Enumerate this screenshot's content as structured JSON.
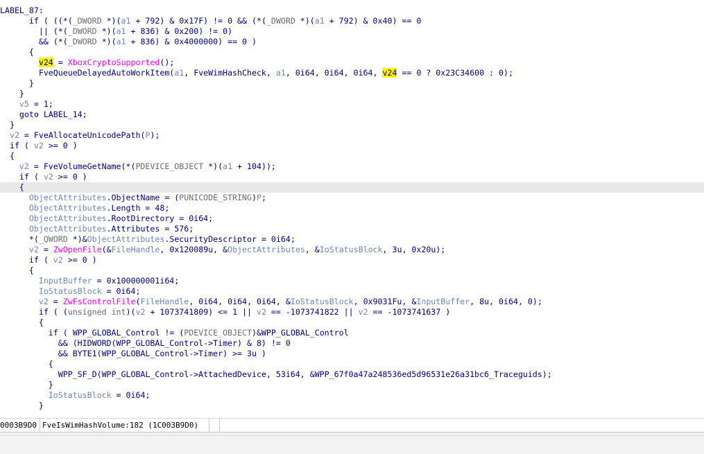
{
  "code_lines": [
    {
      "current": false,
      "tokens": [
        {
          "t": "LABEL_87:",
          "c": "label"
        }
      ]
    },
    {
      "current": false,
      "tokens": [
        {
          "t": "      if ( ((*(",
          "c": "plain"
        },
        {
          "t": "_DWORD",
          "c": "type"
        },
        {
          "t": " *)(",
          "c": "plain"
        },
        {
          "t": "a1",
          "c": "var"
        },
        {
          "t": " + 792) & 0x17F) != 0 && (*(",
          "c": "plain"
        },
        {
          "t": "_DWORD",
          "c": "type"
        },
        {
          "t": " *)(",
          "c": "plain"
        },
        {
          "t": "a1",
          "c": "var"
        },
        {
          "t": " + 792) & 0x40) == 0",
          "c": "plain"
        }
      ]
    },
    {
      "current": false,
      "tokens": [
        {
          "t": "        || (*(",
          "c": "plain"
        },
        {
          "t": "_DWORD",
          "c": "type"
        },
        {
          "t": " *)(",
          "c": "plain"
        },
        {
          "t": "a1",
          "c": "var"
        },
        {
          "t": " + 836) & 0x200) != 0)",
          "c": "plain"
        }
      ]
    },
    {
      "current": false,
      "tokens": [
        {
          "t": "        && (*(",
          "c": "plain"
        },
        {
          "t": "_DWORD",
          "c": "type"
        },
        {
          "t": " *)(",
          "c": "plain"
        },
        {
          "t": "a1",
          "c": "var"
        },
        {
          "t": " + 836) & 0x4000000) == 0 )",
          "c": "plain"
        }
      ]
    },
    {
      "current": false,
      "tokens": [
        {
          "t": "      {",
          "c": "plain"
        }
      ]
    },
    {
      "current": false,
      "tokens": [
        {
          "t": "        ",
          "c": "plain"
        },
        {
          "t": "v24",
          "c": "hl"
        },
        {
          "t": " = ",
          "c": "plain"
        },
        {
          "t": "XboxCryptoSupported",
          "c": "fn"
        },
        {
          "t": "();",
          "c": "plain"
        }
      ]
    },
    {
      "current": false,
      "tokens": [
        {
          "t": "        FveQueueDelayedAutoWorkItem(",
          "c": "plain"
        },
        {
          "t": "a1",
          "c": "var"
        },
        {
          "t": ", FveWimHashCheck, ",
          "c": "plain"
        },
        {
          "t": "a1",
          "c": "var"
        },
        {
          "t": ", 0i64, 0i64, 0i64, ",
          "c": "plain"
        },
        {
          "t": "v24",
          "c": "hl"
        },
        {
          "t": " == 0 ? 0x23C34600 : 0);",
          "c": "plain"
        }
      ]
    },
    {
      "current": false,
      "tokens": [
        {
          "t": "      }",
          "c": "plain"
        }
      ]
    },
    {
      "current": false,
      "tokens": [
        {
          "t": "    }",
          "c": "plain"
        }
      ]
    },
    {
      "current": false,
      "tokens": [
        {
          "t": "    ",
          "c": "plain"
        },
        {
          "t": "v5",
          "c": "var"
        },
        {
          "t": " = 1;",
          "c": "plain"
        }
      ]
    },
    {
      "current": false,
      "tokens": [
        {
          "t": "    goto LABEL_14;",
          "c": "plain"
        }
      ]
    },
    {
      "current": false,
      "tokens": [
        {
          "t": "  }",
          "c": "plain"
        }
      ]
    },
    {
      "current": false,
      "tokens": [
        {
          "t": "  ",
          "c": "plain"
        },
        {
          "t": "v2",
          "c": "var"
        },
        {
          "t": " = FveAllocateUnicodePath(",
          "c": "plain"
        },
        {
          "t": "P",
          "c": "var"
        },
        {
          "t": ");",
          "c": "plain"
        }
      ]
    },
    {
      "current": false,
      "tokens": [
        {
          "t": "  if ( ",
          "c": "plain"
        },
        {
          "t": "v2",
          "c": "var"
        },
        {
          "t": " >= 0 )",
          "c": "plain"
        }
      ]
    },
    {
      "current": false,
      "tokens": [
        {
          "t": "  {",
          "c": "plain"
        }
      ]
    },
    {
      "current": false,
      "tokens": [
        {
          "t": "    ",
          "c": "plain"
        },
        {
          "t": "v2",
          "c": "var"
        },
        {
          "t": " = FveVolumeGetName(*(",
          "c": "plain"
        },
        {
          "t": "PDEVICE_OBJECT",
          "c": "type"
        },
        {
          "t": " *)(",
          "c": "plain"
        },
        {
          "t": "a1",
          "c": "var"
        },
        {
          "t": " + 104));",
          "c": "plain"
        }
      ]
    },
    {
      "current": false,
      "tokens": [
        {
          "t": "    if ( ",
          "c": "plain"
        },
        {
          "t": "v2",
          "c": "var"
        },
        {
          "t": " >= 0 )",
          "c": "plain"
        }
      ]
    },
    {
      "current": true,
      "tokens": [
        {
          "t": "    {",
          "c": "plain"
        }
      ]
    },
    {
      "current": false,
      "tokens": [
        {
          "t": "      ",
          "c": "plain"
        },
        {
          "t": "ObjectAttributes",
          "c": "var"
        },
        {
          "t": ".ObjectName = (",
          "c": "plain"
        },
        {
          "t": "PUNICODE_STRING",
          "c": "type"
        },
        {
          "t": ")",
          "c": "plain"
        },
        {
          "t": "P",
          "c": "var"
        },
        {
          "t": ";",
          "c": "plain"
        }
      ]
    },
    {
      "current": false,
      "tokens": [
        {
          "t": "      ",
          "c": "plain"
        },
        {
          "t": "ObjectAttributes",
          "c": "var"
        },
        {
          "t": ".Length = 48;",
          "c": "plain"
        }
      ]
    },
    {
      "current": false,
      "tokens": [
        {
          "t": "      ",
          "c": "plain"
        },
        {
          "t": "ObjectAttributes",
          "c": "var"
        },
        {
          "t": ".RootDirectory = 0i64;",
          "c": "plain"
        }
      ]
    },
    {
      "current": false,
      "tokens": [
        {
          "t": "      ",
          "c": "plain"
        },
        {
          "t": "ObjectAttributes",
          "c": "var"
        },
        {
          "t": ".Attributes = 576;",
          "c": "plain"
        }
      ]
    },
    {
      "current": false,
      "tokens": [
        {
          "t": "      *(",
          "c": "plain"
        },
        {
          "t": "_QWORD",
          "c": "type"
        },
        {
          "t": " *)&",
          "c": "plain"
        },
        {
          "t": "ObjectAttributes",
          "c": "var"
        },
        {
          "t": ".SecurityDescriptor = 0i64;",
          "c": "plain"
        }
      ]
    },
    {
      "current": false,
      "tokens": [
        {
          "t": "      ",
          "c": "plain"
        },
        {
          "t": "v2",
          "c": "var"
        },
        {
          "t": " = ",
          "c": "plain"
        },
        {
          "t": "ZwOpenFile",
          "c": "fn"
        },
        {
          "t": "(&",
          "c": "plain"
        },
        {
          "t": "FileHandle",
          "c": "var"
        },
        {
          "t": ", 0x120089u, &",
          "c": "plain"
        },
        {
          "t": "ObjectAttributes",
          "c": "var"
        },
        {
          "t": ", &",
          "c": "plain"
        },
        {
          "t": "IoStatusBlock",
          "c": "var"
        },
        {
          "t": ", 3u, 0x20u);",
          "c": "plain"
        }
      ]
    },
    {
      "current": false,
      "tokens": [
        {
          "t": "      if ( ",
          "c": "plain"
        },
        {
          "t": "v2",
          "c": "var"
        },
        {
          "t": " >= 0 )",
          "c": "plain"
        }
      ]
    },
    {
      "current": false,
      "tokens": [
        {
          "t": "      {",
          "c": "plain"
        }
      ]
    },
    {
      "current": false,
      "tokens": [
        {
          "t": "        ",
          "c": "plain"
        },
        {
          "t": "InputBuffer",
          "c": "var"
        },
        {
          "t": " = 0x100000001i64;",
          "c": "plain"
        }
      ]
    },
    {
      "current": false,
      "tokens": [
        {
          "t": "        ",
          "c": "plain"
        },
        {
          "t": "IoStatusBlock",
          "c": "var"
        },
        {
          "t": " = 0i64;",
          "c": "plain"
        }
      ]
    },
    {
      "current": false,
      "tokens": [
        {
          "t": "        ",
          "c": "plain"
        },
        {
          "t": "v2",
          "c": "var"
        },
        {
          "t": " = ",
          "c": "plain"
        },
        {
          "t": "ZwFsControlFile",
          "c": "fn"
        },
        {
          "t": "(",
          "c": "plain"
        },
        {
          "t": "FileHandle",
          "c": "var"
        },
        {
          "t": ", 0i64, 0i64, 0i64, &",
          "c": "plain"
        },
        {
          "t": "IoStatusBlock",
          "c": "var"
        },
        {
          "t": ", 0x9031Fu, &",
          "c": "plain"
        },
        {
          "t": "InputBuffer",
          "c": "var"
        },
        {
          "t": ", 8u, 0i64, 0);",
          "c": "plain"
        }
      ]
    },
    {
      "current": false,
      "tokens": [
        {
          "t": "        if ( (",
          "c": "plain"
        },
        {
          "t": "unsigned int",
          "c": "type"
        },
        {
          "t": ")(",
          "c": "plain"
        },
        {
          "t": "v2",
          "c": "var"
        },
        {
          "t": " + 1073741809) <= 1 || ",
          "c": "plain"
        },
        {
          "t": "v2",
          "c": "var"
        },
        {
          "t": " == -1073741822 || ",
          "c": "plain"
        },
        {
          "t": "v2",
          "c": "var"
        },
        {
          "t": " == -1073741637 )",
          "c": "plain"
        }
      ]
    },
    {
      "current": false,
      "tokens": [
        {
          "t": "        {",
          "c": "plain"
        }
      ]
    },
    {
      "current": false,
      "tokens": [
        {
          "t": "          if ( WPP_GLOBAL_Control != (",
          "c": "plain"
        },
        {
          "t": "PDEVICE_OBJECT",
          "c": "type"
        },
        {
          "t": ")&WPP_GLOBAL_Control",
          "c": "plain"
        }
      ]
    },
    {
      "current": false,
      "tokens": [
        {
          "t": "            && (HIDWORD(WPP_GLOBAL_Control->Timer) & 8) != 0",
          "c": "plain"
        }
      ]
    },
    {
      "current": false,
      "tokens": [
        {
          "t": "            && BYTE1(WPP_GLOBAL_Control->Timer) >= 3u )",
          "c": "plain"
        }
      ]
    },
    {
      "current": false,
      "tokens": [
        {
          "t": "          {",
          "c": "plain"
        }
      ]
    },
    {
      "current": false,
      "tokens": [
        {
          "t": "            WPP_SF_D(WPP_GLOBAL_Control->AttachedDevice, 53i64, &WPP_67f0a47a248536ed5d96531e26a31bc6_Traceguids);",
          "c": "plain"
        }
      ]
    },
    {
      "current": false,
      "tokens": [
        {
          "t": "          }",
          "c": "plain"
        }
      ]
    },
    {
      "current": false,
      "tokens": [
        {
          "t": "          ",
          "c": "plain"
        },
        {
          "t": "IoStatusBlock",
          "c": "var"
        },
        {
          "t": " = 0i64;",
          "c": "plain"
        }
      ]
    },
    {
      "current": false,
      "tokens": [
        {
          "t": "        }",
          "c": "plain"
        }
      ]
    }
  ],
  "status_bar": {
    "address": "0003B9D0",
    "location": "FveIsWimHashVolume:182 (1C003B9D0)"
  }
}
